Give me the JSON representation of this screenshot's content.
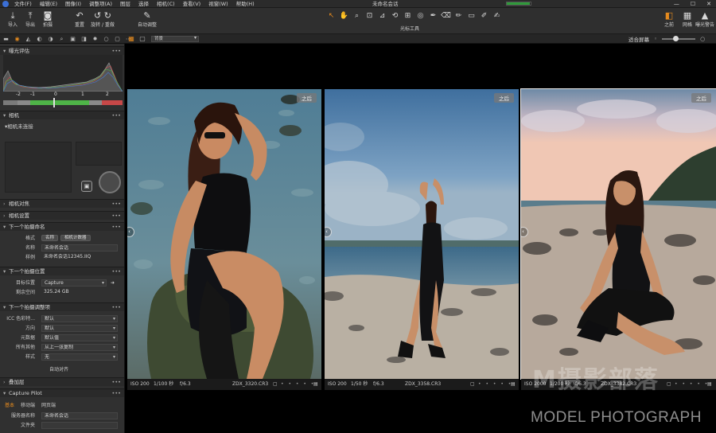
{
  "menubar": {
    "items": [
      "文件(F)",
      "编辑(E)",
      "图像(I)",
      "调整项(A)",
      "图层",
      "选择",
      "相机(C)",
      "查看(V)",
      "视窗(W)",
      "帮助(H)"
    ],
    "session_title": "未命名会话",
    "progress_fraction": 0.95,
    "window_buttons": [
      "—",
      "☐",
      "✕"
    ]
  },
  "toolbar": {
    "import": "导入",
    "export": "导出",
    "capture": "拍摄",
    "reset": "重置",
    "rotate": "旋转 / 重做",
    "auto_adjust": "自动调整",
    "cursor_tools_label": "光标工具",
    "before_after": "之前",
    "grid": "网格",
    "exposure_warning": "曝光警告"
  },
  "subbar": {
    "album": "背景",
    "fit_screen": "适合屏幕"
  },
  "left_panel": {
    "exposure_section": "曝光评估",
    "hist_scale": [
      "-2",
      "-1",
      "0",
      "1",
      "2"
    ],
    "camera_section": "相机",
    "camera_status": "相机未连接",
    "camera_focus_section": "相机对焦",
    "camera_settings_section": "相机设置",
    "next_capture_naming": "下一个拍摄命名",
    "format_label": "格式",
    "format_chip_1": "名称",
    "format_chip_2": "相机计数器",
    "name_label": "名称",
    "name_value": "未命名会话",
    "sample_label": "样例",
    "sample_value": "未命名会话12345.IIQ",
    "next_capture_location": "下一个拍摄位置",
    "destination_label": "目标位置",
    "destination_value": "Capture",
    "free_space_label": "剩余空间",
    "free_space_value": "325.24 GB",
    "next_capture_adjust": "下一个拍摄调整项",
    "icc_label": "ICC 色彩特...",
    "icc_value": "默认",
    "orientation_label": "方向",
    "orientation_value": "默认",
    "metadata_label": "元数据",
    "metadata_value": "默认值",
    "others_label": "所有其他",
    "others_value": "从上一张复制",
    "style_label": "样式",
    "style_value": "无",
    "auto_align": "自动对齐",
    "overlay_section": "叠加层",
    "capture_pilot_section": "Capture Pilot",
    "pilot_tabs": [
      "基本",
      "移动端",
      "网页端"
    ],
    "server_name_label": "服务器名称",
    "server_name_value": "未命名会话",
    "file_label": "文件夹"
  },
  "viewer": {
    "after_badge": "之后",
    "photos": [
      {
        "iso": "ISO 200",
        "shutter": "1/100 秒",
        "aperture": "f/6.3",
        "filename": "ZDX_3320.CR3"
      },
      {
        "iso": "ISO 200",
        "shutter": "1/50 秒",
        "aperture": "f/6.3",
        "filename": "ZDX_3358.CR3"
      },
      {
        "iso": "ISO 2000",
        "shutter": "1/200 秒",
        "aperture": "f/6.3",
        "filename": "ZDX_3382.CR3"
      }
    ],
    "rating_dots": "• • • • •"
  },
  "watermark": {
    "logo": "M摄影部落",
    "text": "MODEL PHOTOGRAPH"
  },
  "colors": {
    "accent": "#e48a1e",
    "panel": "#303030",
    "viewer_bg": "#000000"
  }
}
